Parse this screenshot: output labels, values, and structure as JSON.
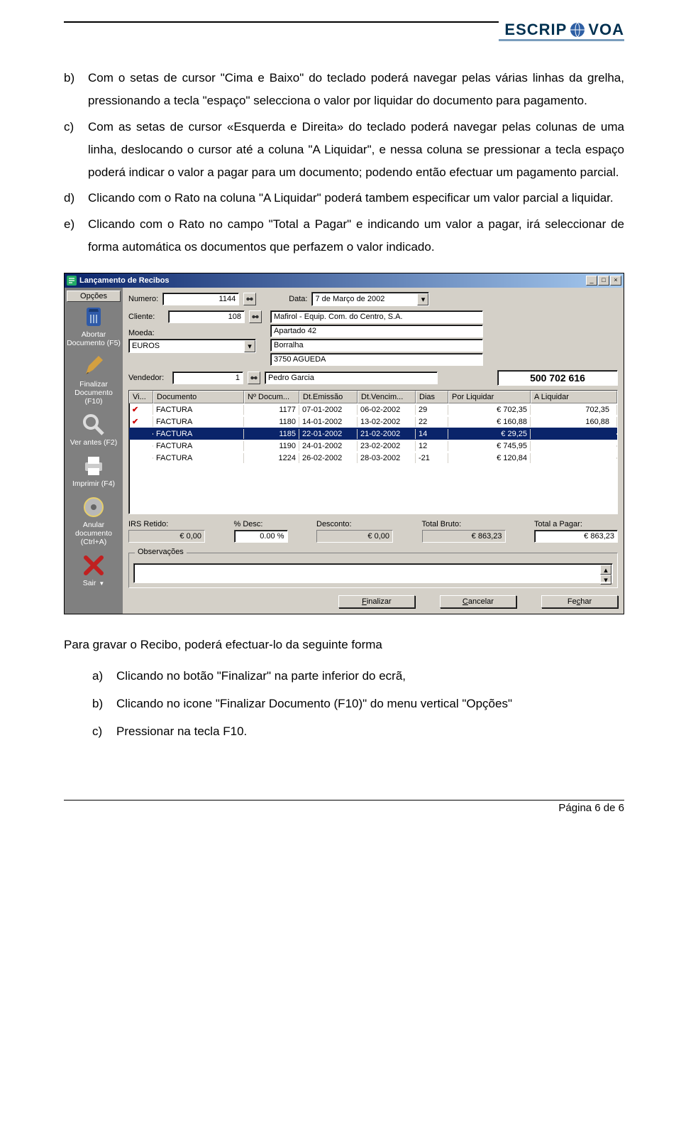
{
  "logo": {
    "part1": "ESCRIP",
    "part2": "VOA"
  },
  "text": {
    "b": "Com o setas de cursor \"Cima e Baixo\" do teclado poderá navegar pelas várias linhas da grelha, pressionando a tecla \"espaço\" selecciona o valor por liquidar do documento para pagamento.",
    "c": "Com as setas de cursor «Esquerda e Direita» do teclado poderá navegar pelas colunas de uma linha, deslocando o cursor até a coluna \"A Liquidar\", e nessa coluna se pressionar a tecla espaço poderá indicar o valor a pagar para um documento; podendo então efectuar um pagamento parcial.",
    "d": "Clicando com o Rato na coluna \"A Liquidar\" poderá tambem especificar um valor parcial a liquidar.",
    "e": "Clicando com o Rato no campo \"Total a Pagar\" e indicando um valor a pagar, irá seleccionar de forma automática os documentos que perfazem o valor indicado."
  },
  "window": {
    "title": "Lançamento de Recibos",
    "sidebar": {
      "tab": "Opções",
      "items": [
        {
          "label": "Abortar Documento (F5)"
        },
        {
          "label": "Finalizar Documento (F10)"
        },
        {
          "label": "Ver antes (F2)"
        },
        {
          "label": "Imprimir (F4)"
        },
        {
          "label": "Anular documento (Ctrl+A)"
        },
        {
          "label": "Sair"
        }
      ]
    },
    "fields": {
      "numero_label": "Numero:",
      "numero": "1144",
      "data_label": "Data:",
      "data": "7 de   Março   de 2002",
      "cliente_label": "Cliente:",
      "cliente": "108",
      "cliente_nome": "Mafirol - Equip. Com. do Centro, S.A.",
      "addr1": "Apartado 42",
      "addr2": "Borralha",
      "addr3": "3750 AGUEDA",
      "moeda_label": "Moeda:",
      "moeda": "EUROS",
      "vendedor_label": "Vendedor:",
      "vendedor": "1",
      "vendedor_nome": "Pedro Garcia",
      "nif": "500 702 616"
    },
    "grid": {
      "headers": [
        "Vi...",
        "Documento",
        "Nº Docum...",
        "Dt.Emissão",
        "Dt.Vencim...",
        "Dias",
        "Por Liquidar",
        "A Liquidar"
      ],
      "rows": [
        {
          "sel": true,
          "vi": "✔",
          "doc": "FACTURA",
          "num": "1177",
          "emi": "07-01-2002",
          "ven": "06-02-2002",
          "dias": "29",
          "por": "€ 702,35",
          "liq": "702,35"
        },
        {
          "sel": true,
          "vi": "✔",
          "doc": "FACTURA",
          "num": "1180",
          "emi": "14-01-2002",
          "ven": "13-02-2002",
          "dias": "22",
          "por": "€ 160,88",
          "liq": "160,88"
        },
        {
          "sel": false,
          "vi": "",
          "doc": "FACTURA",
          "num": "1185",
          "emi": "22-01-2002",
          "ven": "21-02-2002",
          "dias": "14",
          "por": "€ 29,25",
          "liq": "",
          "highlighted": true
        },
        {
          "sel": false,
          "vi": "",
          "doc": "FACTURA",
          "num": "1190",
          "emi": "24-01-2002",
          "ven": "23-02-2002",
          "dias": "12",
          "por": "€ 745,95",
          "liq": ""
        },
        {
          "sel": false,
          "vi": "",
          "doc": "FACTURA",
          "num": "1224",
          "emi": "26-02-2002",
          "ven": "28-03-2002",
          "dias": "-21",
          "por": "€ 120,84",
          "liq": ""
        }
      ]
    },
    "totals": {
      "irs_label": "IRS Retido:",
      "irs": "€ 0,00",
      "pdesc_label": "% Desc:",
      "pdesc": "0.00 %",
      "desc_label": "Desconto:",
      "desc": "€ 0,00",
      "bruto_label": "Total Bruto:",
      "bruto": "€ 863,23",
      "pagar_label": "Total a Pagar:",
      "pagar": "€ 863,23"
    },
    "obs_label": "Observações",
    "buttons": {
      "finalizar": "Finalizar",
      "cancelar": "Cancelar",
      "fechar": "Fechar"
    }
  },
  "after": {
    "intro": "Para gravar o Recibo, poderá efectuar-lo da seguinte forma",
    "a": "Clicando no botão \"Finalizar\" na parte inferior do ecrã,",
    "b": "Clicando no icone \"Finalizar Documento (F10)\" do menu vertical \"Opções\"",
    "c": "Pressionar na tecla F10."
  },
  "footer": "Página 6 de 6"
}
